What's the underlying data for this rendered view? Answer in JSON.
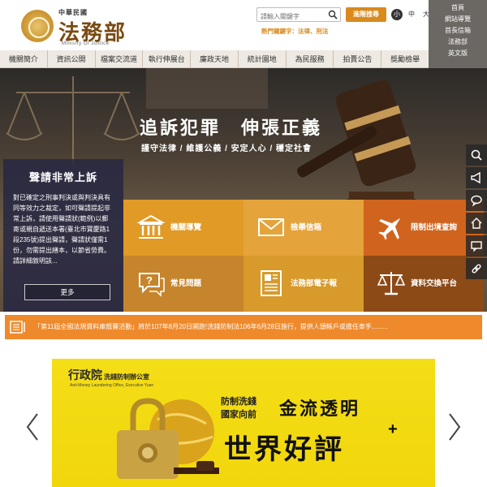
{
  "header": {
    "logo_top": "中華民國",
    "logo_main": "法務部",
    "logo_sub": "Ministry Of Justice",
    "search_placeholder": "請輸入關鍵字",
    "advanced_search": "進階搜尋",
    "hot_keywords": "熱門關鍵字：法律、刑法",
    "font_sizes": [
      "小",
      "中",
      "大"
    ]
  },
  "right_links": [
    "首頁",
    "網站導覽",
    "首長信箱",
    "法務部",
    "英文版"
  ],
  "nav": [
    "機關簡介",
    "資訊公開",
    "檔案交流道",
    "執行伸展台",
    "廉政天地",
    "統計園地",
    "為民服務",
    "拍賣公告",
    "獎勵檢舉"
  ],
  "hero": {
    "slogan": "追訴犯罪　伸張正義",
    "subtitle": "謹守法律 / 維護公義 / 安定人心 / 穩定社會"
  },
  "notice": {
    "title": "聲請非常上訴",
    "body": "對已確定之刑事判決或與判決具有同等效力之裁定，如可聲請提起非常上訴，請使用聲請狀(範例)以郵寄或親自遞送本署(臺北市寶慶路1段235號)提出聲請，聲請狀僅需1份，勿需提出繕本，以節省勞費。請詳細敘明該...",
    "more": "更多"
  },
  "tiles": [
    {
      "label": "機關導覽",
      "icon": "building-icon",
      "color": "#e09a25"
    },
    {
      "label": "檢舉信箱",
      "icon": "envelope-icon",
      "color": "#e5a33b"
    },
    {
      "label": "限制出境查詢",
      "icon": "airplane-icon",
      "color": "#d0641e"
    },
    {
      "label": "常見問題",
      "icon": "question-bubble-icon",
      "color": "#c6852c"
    },
    {
      "label": "法務部電子報",
      "icon": "newspaper-icon",
      "color": "#d79a2b"
    },
    {
      "label": "資料交換平台",
      "icon": "scales-icon",
      "color": "#8c4a17"
    }
  ],
  "side_icons": [
    "search-icon",
    "megaphone-icon",
    "chat-icon",
    "home-icon",
    "comment-icon",
    "link-icon"
  ],
  "marquee": "「第11屆全國法規資料庫競賽活動」將於107年8月20日開跑!洗錢防制法106年6月28日施行，提供人頭帳戶或擔任車手.........",
  "banner": {
    "org": "行政院",
    "org_unit": "洗錢防制辦公室",
    "org_en": "Anti-Money Laundering Office, Executive Yuan",
    "line1": "防制洗錢",
    "line2": "國家向前",
    "title1": "金流透明",
    "title2": "世界好評",
    "plus": "+"
  },
  "colors": {
    "accent": "#d88a1e",
    "marquee": "#ee8a2c",
    "banner": "#f2d90f",
    "notice_bg": "#28284a"
  }
}
